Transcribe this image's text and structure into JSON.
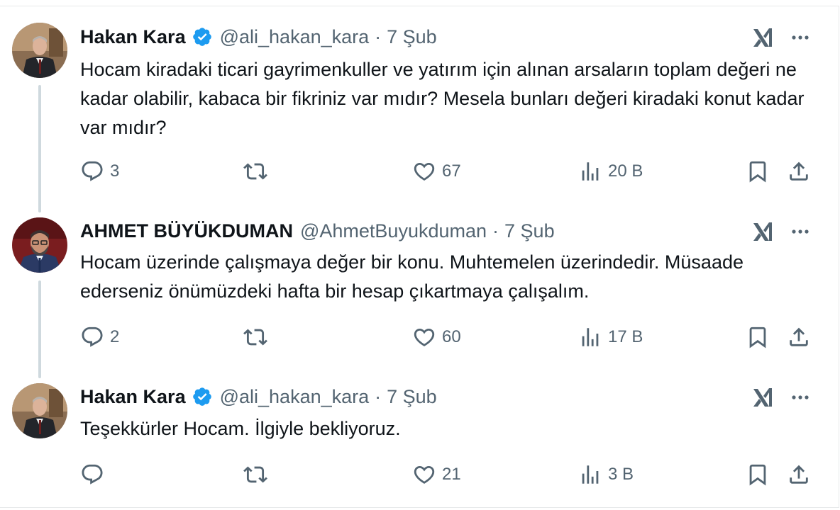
{
  "tweets": [
    {
      "name": "Hakan Kara",
      "handle": "@ali_hakan_kara",
      "dot": "·",
      "time": "7 Şub",
      "text": "Hocam kiradaki ticari gayrimenkuller ve yatırım için alınan arsaların toplam değeri ne kadar olabilir, kabaca bir fikriniz var mıdır? Mesela bunları değeri kiradaki konut kadar var mıdır?",
      "replies": "3",
      "retweets": "",
      "likes": "67",
      "views": "20 B",
      "verified": true
    },
    {
      "name": "AHMET BÜYÜKDUMAN",
      "handle": "@AhmetBuyukduman",
      "dot": "·",
      "time": "7 Şub",
      "text": "Hocam üzerinde çalışmaya değer bir konu. Muhtemelen üzerindedir. Müsaade ederseniz önümüzdeki hafta bir hesap çıkartmaya çalışalım.",
      "replies": "2",
      "retweets": "",
      "likes": "60",
      "views": "17 B",
      "verified": false
    },
    {
      "name": "Hakan Kara",
      "handle": "@ali_hakan_kara",
      "dot": "·",
      "time": "7 Şub",
      "text": "Teşekkürler Hocam. İlgiyle bekliyoruz.",
      "replies": "",
      "retweets": "",
      "likes": "21",
      "views": "3 B",
      "verified": true
    }
  ],
  "icons": {
    "verified": "verified-badge-icon",
    "grok": "grok-icon",
    "more": "more-icon",
    "reply": "reply-icon",
    "retweet": "retweet-icon",
    "like": "like-icon",
    "views": "views-icon",
    "bookmark": "bookmark-icon",
    "share": "share-icon"
  },
  "colors": {
    "text": "#0f1419",
    "secondary": "#536471",
    "verified": "#1d9bf0",
    "thread_line": "#cfd9de"
  }
}
